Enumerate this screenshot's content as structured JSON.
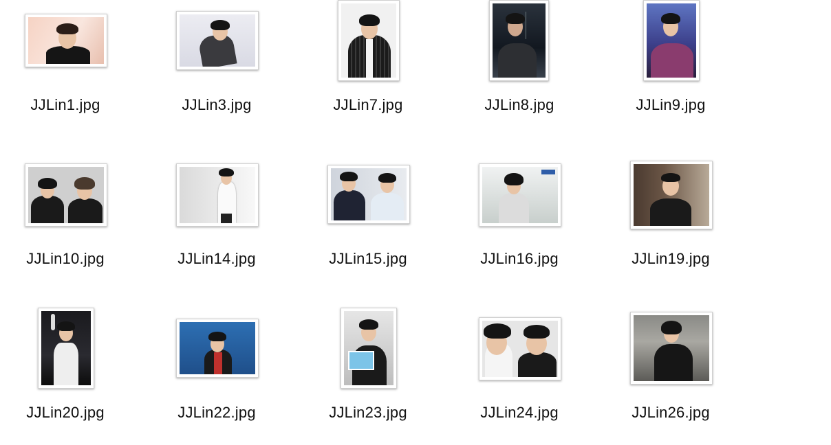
{
  "files": [
    {
      "name": "JJLin1.jpg"
    },
    {
      "name": "JJLin3.jpg"
    },
    {
      "name": "JJLin7.jpg"
    },
    {
      "name": "JJLin8.jpg"
    },
    {
      "name": "JJLin9.jpg"
    },
    {
      "name": "JJLin10.jpg"
    },
    {
      "name": "JJLin14.jpg"
    },
    {
      "name": "JJLin15.jpg"
    },
    {
      "name": "JJLin16.jpg"
    },
    {
      "name": "JJLin19.jpg"
    },
    {
      "name": "JJLin20.jpg"
    },
    {
      "name": "JJLin22.jpg"
    },
    {
      "name": "JJLin23.jpg"
    },
    {
      "name": "JJLin24.jpg"
    },
    {
      "name": "JJLin26.jpg"
    }
  ]
}
